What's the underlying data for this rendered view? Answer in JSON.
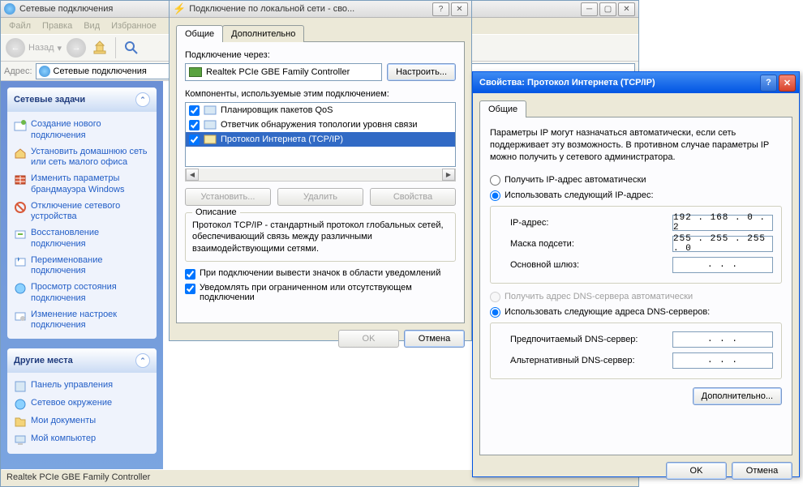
{
  "main": {
    "title": "Сетевые подключения",
    "menu": [
      "Файл",
      "Правка",
      "Вид",
      "Избранное"
    ],
    "back": "Назад",
    "address_lbl": "Адрес:",
    "address_val": "Сетевые подключения",
    "status": "Realtek PCIe GBE Family Controller"
  },
  "sidebar": {
    "tasks_head": "Сетевые задачи",
    "tasks": [
      "Создание нового подключения",
      "Установить домашнюю сеть или сеть малого офиса",
      "Изменить параметры брандмауэра Windows",
      "Отключение сетевого устройства",
      "Восстановление подключения",
      "Переименование подключения",
      "Просмотр состояния подключения",
      "Изменение настроек подключения"
    ],
    "places_head": "Другие места",
    "places": [
      "Панель управления",
      "Сетевое окружение",
      "Мои документы",
      "Мой компьютер"
    ]
  },
  "props": {
    "title": "Подключение по локальной сети - сво...",
    "tab_general": "Общие",
    "tab_advanced": "Дополнительно",
    "connect_via": "Подключение через:",
    "adapter": "Realtek PCIe GBE Family Controller",
    "configure": "Настроить...",
    "components_lbl": "Компоненты, используемые этим подключением:",
    "components": [
      "Планировщик пакетов QoS",
      "Ответчик обнаружения топологии уровня связи",
      "Протокол Интернета (TCP/IP)"
    ],
    "install": "Установить...",
    "uninstall": "Удалить",
    "properties": "Свойства",
    "desc_head": "Описание",
    "desc_text": "Протокол TCP/IP - стандартный протокол глобальных сетей, обеспечивающий связь между различными взаимодействующими сетями.",
    "chk_tray": "При подключении вывести значок в области уведомлений",
    "chk_notify": "Уведомлять при ограниченном или отсутствующем подключении",
    "ok": "OK",
    "cancel": "Отмена"
  },
  "tcpip": {
    "title": "Свойства: Протокол Интернета (TCP/IP)",
    "tab_general": "Общие",
    "desc": "Параметры IP могут назначаться автоматически, если сеть поддерживает эту возможность. В противном случае параметры IP можно получить у сетевого администратора.",
    "r_auto_ip": "Получить IP-адрес автоматически",
    "r_static_ip": "Использовать следующий IP-адрес:",
    "ip_lbl": "IP-адрес:",
    "ip_val": "192 . 168 .  0  .  2",
    "mask_lbl": "Маска подсети:",
    "mask_val": "255 . 255 . 255 .  0",
    "gw_lbl": "Основной шлюз:",
    "gw_val": " .      .      . ",
    "r_auto_dns": "Получить адрес DNS-сервера автоматически",
    "r_static_dns": "Использовать следующие адреса DNS-серверов:",
    "dns1_lbl": "Предпочитаемый DNS-сервер:",
    "dns2_lbl": "Альтернативный DNS-сервер:",
    "dns_empty": " .      .      . ",
    "advanced": "Дополнительно...",
    "ok": "OK",
    "cancel": "Отмена"
  }
}
